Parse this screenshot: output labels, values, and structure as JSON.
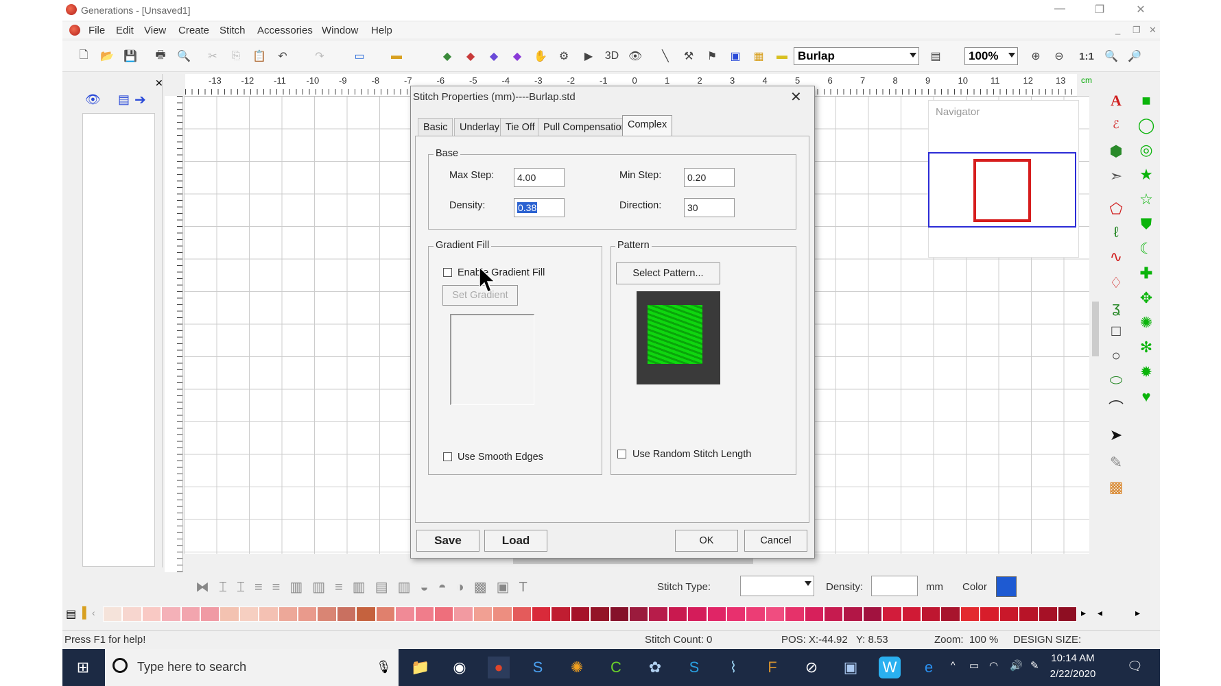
{
  "window": {
    "title": "Generations - [Unsaved1]"
  },
  "menu": [
    "File",
    "Edit",
    "View",
    "Create",
    "Stitch",
    "Accessories",
    "Window",
    "Help"
  ],
  "toolbar": {
    "fabric": "Burlap",
    "zoom": "100%",
    "one_to_one": "1:1"
  },
  "ruler": {
    "h_ticks": [
      "-13",
      "-12",
      "-11",
      "-10",
      "-9",
      "-8",
      "-7",
      "-6",
      "-5",
      "-4",
      "-3",
      "-2",
      "-1",
      "0",
      "1",
      "2",
      "3",
      "4",
      "5",
      "6",
      "7",
      "8",
      "9",
      "10",
      "11",
      "12",
      "13"
    ],
    "unit": "cm"
  },
  "navigator": {
    "title": "Navigator"
  },
  "dialog": {
    "title": "Stitch Properties  (mm)----Burlap.std",
    "tabs": [
      "Basic",
      "Underlay",
      "Tie Off",
      "Pull Compensation",
      "Complex"
    ],
    "active_tab": "Complex",
    "base": {
      "label": "Base",
      "max_step_label": "Max Step:",
      "max_step": "4.00",
      "min_step_label": "Min Step:",
      "min_step": "0.20",
      "density_label": "Density:",
      "density": "0.38",
      "direction_label": "Direction:",
      "direction": "30"
    },
    "gradient": {
      "label": "Gradient Fill",
      "enable_label": "Enable Gradient Fill",
      "set_label": "Set Gradient",
      "smooth_label": "Use Smooth Edges"
    },
    "pattern": {
      "label": "Pattern",
      "select_label": "Select Pattern...",
      "random_label": "Use Random Stitch Length"
    },
    "buttons": {
      "save": "Save",
      "load": "Load",
      "ok": "OK",
      "cancel": "Cancel"
    }
  },
  "bottom_toolbar": {
    "stitch_type_label": "Stitch Type:",
    "density_label": "Density:",
    "unit": "mm",
    "color_label": "Color",
    "color": "#1e5ad2"
  },
  "status": {
    "help": "Press F1 for help!",
    "stitch_count": "Stitch Count: 0",
    "pos": "POS: X:-44.92   Y: 8.53",
    "zoom": "Zoom:  100 %",
    "design_size": "DESIGN SIZE:"
  },
  "taskbar": {
    "search_placeholder": "Type here to search",
    "time": "10:14 AM",
    "date": "2/22/2020"
  },
  "palette": [
    "#f5e3da",
    "#f7d6cf",
    "#f9c9c4",
    "#f4b1b8",
    "#f2a5ae",
    "#f09aa4",
    "#f3c2b1",
    "#f6cfc1",
    "#f4c1b3",
    "#eda899",
    "#e99a8c",
    "#d98574",
    "#c97060",
    "#c5623e",
    "#e0806d",
    "#f08a96",
    "#f07d8b",
    "#ee6f7c",
    "#f29aa1",
    "#f1a093",
    "#ed8e80",
    "#e45b5b",
    "#d92a3a",
    "#c01d31",
    "#a6122a",
    "#941427",
    "#85112a",
    "#9b1b3d",
    "#b71c4a",
    "#c9194f",
    "#d41c5a",
    "#e02566",
    "#e8306e",
    "#ec3d75",
    "#f04d80",
    "#e6326a",
    "#d7205b",
    "#c61b4f",
    "#b21646",
    "#a1123f",
    "#d21c3b",
    "#d01a35",
    "#be1630",
    "#a8142d",
    "#e32a2f",
    "#d81d2b",
    "#c9182a",
    "#b81428",
    "#a61126",
    "#8e0e22"
  ]
}
